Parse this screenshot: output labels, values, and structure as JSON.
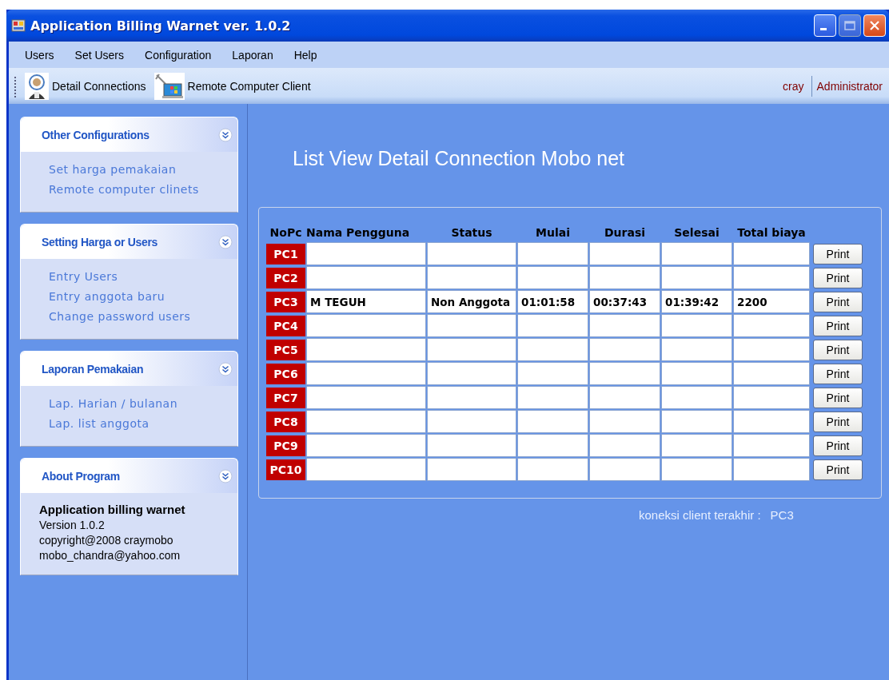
{
  "window": {
    "title": "Application Billing Warnet ver. 1.0.2"
  },
  "menu": [
    "Users",
    "Set Users",
    "Configuration",
    "Laporan",
    "Help"
  ],
  "toolbar": {
    "buttons": [
      {
        "label": "Detail Connections",
        "kind": "person"
      },
      {
        "label": "Remote Computer Client",
        "kind": "remote"
      }
    ],
    "user": "cray",
    "role": "Administrator"
  },
  "sidebar": [
    {
      "title": "Other Configurations",
      "kind": "links",
      "items": [
        "Set harga pemakaian",
        "Remote computer clinets"
      ]
    },
    {
      "title": "Setting Harga or Users",
      "kind": "links",
      "items": [
        "Entry Users",
        "Entry anggota baru",
        "Change password users"
      ]
    },
    {
      "title": "Laporan Pemakaian",
      "kind": "links",
      "items": [
        "Lap. Harian / bulanan",
        "Lap. list anggota"
      ]
    },
    {
      "title": "About Program",
      "kind": "about",
      "heading": "Application billing warnet",
      "items": [
        "Version 1.0.2",
        "copyright@2008 craymobo",
        "mobo_chandra@yahoo.com"
      ]
    }
  ],
  "main": {
    "heading": "List View Detail Connection Mobo net",
    "columns": [
      "NoPc",
      "Nama Pengguna",
      "Status",
      "Mulai",
      "Durasi",
      "Selesai",
      "Total biaya"
    ],
    "rows": [
      {
        "pc": "PC1",
        "print": "Print"
      },
      {
        "pc": "PC2",
        "print": "Print"
      },
      {
        "pc": "PC3",
        "cells": [
          "M TEGUH",
          "Non Anggota",
          "01:01:58",
          "00:37:43",
          "01:39:42",
          "2200"
        ],
        "print": "Print"
      },
      {
        "pc": "PC4",
        "print": "Print"
      },
      {
        "pc": "PC5",
        "print": "Print"
      },
      {
        "pc": "PC6",
        "print": "Print"
      },
      {
        "pc": "PC7",
        "print": "Print"
      },
      {
        "pc": "PC8",
        "print": "Print"
      },
      {
        "pc": "PC9",
        "print": "Print"
      },
      {
        "pc": "PC10",
        "print": "Print"
      }
    ],
    "last_label": "koneksi client terakhir :",
    "last_value": "PC3"
  }
}
